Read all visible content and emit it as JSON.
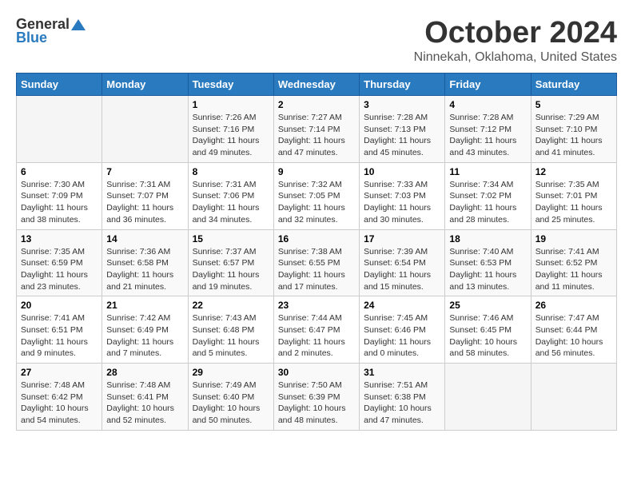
{
  "header": {
    "logo_general": "General",
    "logo_blue": "Blue",
    "month": "October 2024",
    "location": "Ninnekah, Oklahoma, United States"
  },
  "days_of_week": [
    "Sunday",
    "Monday",
    "Tuesday",
    "Wednesday",
    "Thursday",
    "Friday",
    "Saturday"
  ],
  "weeks": [
    [
      {
        "day": "",
        "info": ""
      },
      {
        "day": "",
        "info": ""
      },
      {
        "day": "1",
        "info": "Sunrise: 7:26 AM\nSunset: 7:16 PM\nDaylight: 11 hours and 49 minutes."
      },
      {
        "day": "2",
        "info": "Sunrise: 7:27 AM\nSunset: 7:14 PM\nDaylight: 11 hours and 47 minutes."
      },
      {
        "day": "3",
        "info": "Sunrise: 7:28 AM\nSunset: 7:13 PM\nDaylight: 11 hours and 45 minutes."
      },
      {
        "day": "4",
        "info": "Sunrise: 7:28 AM\nSunset: 7:12 PM\nDaylight: 11 hours and 43 minutes."
      },
      {
        "day": "5",
        "info": "Sunrise: 7:29 AM\nSunset: 7:10 PM\nDaylight: 11 hours and 41 minutes."
      }
    ],
    [
      {
        "day": "6",
        "info": "Sunrise: 7:30 AM\nSunset: 7:09 PM\nDaylight: 11 hours and 38 minutes."
      },
      {
        "day": "7",
        "info": "Sunrise: 7:31 AM\nSunset: 7:07 PM\nDaylight: 11 hours and 36 minutes."
      },
      {
        "day": "8",
        "info": "Sunrise: 7:31 AM\nSunset: 7:06 PM\nDaylight: 11 hours and 34 minutes."
      },
      {
        "day": "9",
        "info": "Sunrise: 7:32 AM\nSunset: 7:05 PM\nDaylight: 11 hours and 32 minutes."
      },
      {
        "day": "10",
        "info": "Sunrise: 7:33 AM\nSunset: 7:03 PM\nDaylight: 11 hours and 30 minutes."
      },
      {
        "day": "11",
        "info": "Sunrise: 7:34 AM\nSunset: 7:02 PM\nDaylight: 11 hours and 28 minutes."
      },
      {
        "day": "12",
        "info": "Sunrise: 7:35 AM\nSunset: 7:01 PM\nDaylight: 11 hours and 25 minutes."
      }
    ],
    [
      {
        "day": "13",
        "info": "Sunrise: 7:35 AM\nSunset: 6:59 PM\nDaylight: 11 hours and 23 minutes."
      },
      {
        "day": "14",
        "info": "Sunrise: 7:36 AM\nSunset: 6:58 PM\nDaylight: 11 hours and 21 minutes."
      },
      {
        "day": "15",
        "info": "Sunrise: 7:37 AM\nSunset: 6:57 PM\nDaylight: 11 hours and 19 minutes."
      },
      {
        "day": "16",
        "info": "Sunrise: 7:38 AM\nSunset: 6:55 PM\nDaylight: 11 hours and 17 minutes."
      },
      {
        "day": "17",
        "info": "Sunrise: 7:39 AM\nSunset: 6:54 PM\nDaylight: 11 hours and 15 minutes."
      },
      {
        "day": "18",
        "info": "Sunrise: 7:40 AM\nSunset: 6:53 PM\nDaylight: 11 hours and 13 minutes."
      },
      {
        "day": "19",
        "info": "Sunrise: 7:41 AM\nSunset: 6:52 PM\nDaylight: 11 hours and 11 minutes."
      }
    ],
    [
      {
        "day": "20",
        "info": "Sunrise: 7:41 AM\nSunset: 6:51 PM\nDaylight: 11 hours and 9 minutes."
      },
      {
        "day": "21",
        "info": "Sunrise: 7:42 AM\nSunset: 6:49 PM\nDaylight: 11 hours and 7 minutes."
      },
      {
        "day": "22",
        "info": "Sunrise: 7:43 AM\nSunset: 6:48 PM\nDaylight: 11 hours and 5 minutes."
      },
      {
        "day": "23",
        "info": "Sunrise: 7:44 AM\nSunset: 6:47 PM\nDaylight: 11 hours and 2 minutes."
      },
      {
        "day": "24",
        "info": "Sunrise: 7:45 AM\nSunset: 6:46 PM\nDaylight: 11 hours and 0 minutes."
      },
      {
        "day": "25",
        "info": "Sunrise: 7:46 AM\nSunset: 6:45 PM\nDaylight: 10 hours and 58 minutes."
      },
      {
        "day": "26",
        "info": "Sunrise: 7:47 AM\nSunset: 6:44 PM\nDaylight: 10 hours and 56 minutes."
      }
    ],
    [
      {
        "day": "27",
        "info": "Sunrise: 7:48 AM\nSunset: 6:42 PM\nDaylight: 10 hours and 54 minutes."
      },
      {
        "day": "28",
        "info": "Sunrise: 7:48 AM\nSunset: 6:41 PM\nDaylight: 10 hours and 52 minutes."
      },
      {
        "day": "29",
        "info": "Sunrise: 7:49 AM\nSunset: 6:40 PM\nDaylight: 10 hours and 50 minutes."
      },
      {
        "day": "30",
        "info": "Sunrise: 7:50 AM\nSunset: 6:39 PM\nDaylight: 10 hours and 48 minutes."
      },
      {
        "day": "31",
        "info": "Sunrise: 7:51 AM\nSunset: 6:38 PM\nDaylight: 10 hours and 47 minutes."
      },
      {
        "day": "",
        "info": ""
      },
      {
        "day": "",
        "info": ""
      }
    ]
  ]
}
